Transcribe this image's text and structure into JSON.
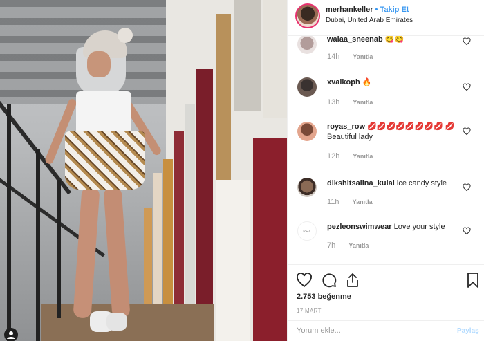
{
  "post_owner": {
    "username": "merhankeller",
    "separator": "•",
    "follow_label": "Takip Et",
    "location": "Dubai, United Arab Emirates"
  },
  "comments": [
    {
      "username": "walaa_sneenab",
      "text": "😋😋",
      "time": "14h",
      "reply_label": "Yanıtla",
      "avatar_icon": "user-avatar-icon"
    },
    {
      "username": "xvalkoph",
      "text": "🔥",
      "time": "13h",
      "reply_label": "Yanıtla",
      "avatar_icon": "user-avatar-icon"
    },
    {
      "username": "royas_row",
      "text": "💋💋💋💋💋💋💋💋 💋 Beautiful lady",
      "time": "12h",
      "reply_label": "Yanıtla",
      "avatar_icon": "user-avatar-icon"
    },
    {
      "username": "dikshitsalina_kulal",
      "text": "ice candy style",
      "time": "11h",
      "reply_label": "Yanıtla",
      "avatar_icon": "user-avatar-icon"
    },
    {
      "username": "pezleonswimwear",
      "text": "Love your style",
      "time": "7h",
      "reply_label": "Yanıtla",
      "avatar_icon": "brand-logo-icon",
      "avatar_text": "PEZ LEON"
    }
  ],
  "actions": {
    "icons": [
      "heart-icon",
      "comment-icon",
      "share-icon",
      "bookmark-icon"
    ]
  },
  "likes": {
    "count_text": "2.753 beğenme"
  },
  "post_date": "17 MART",
  "add_comment": {
    "placeholder": "Yorum ekle...",
    "post_label": "Paylaş"
  },
  "colors": {
    "link_blue": "#3897f0",
    "text": "#262626",
    "muted": "#999999",
    "border": "#efefef",
    "story_ring": "#e8316f"
  }
}
